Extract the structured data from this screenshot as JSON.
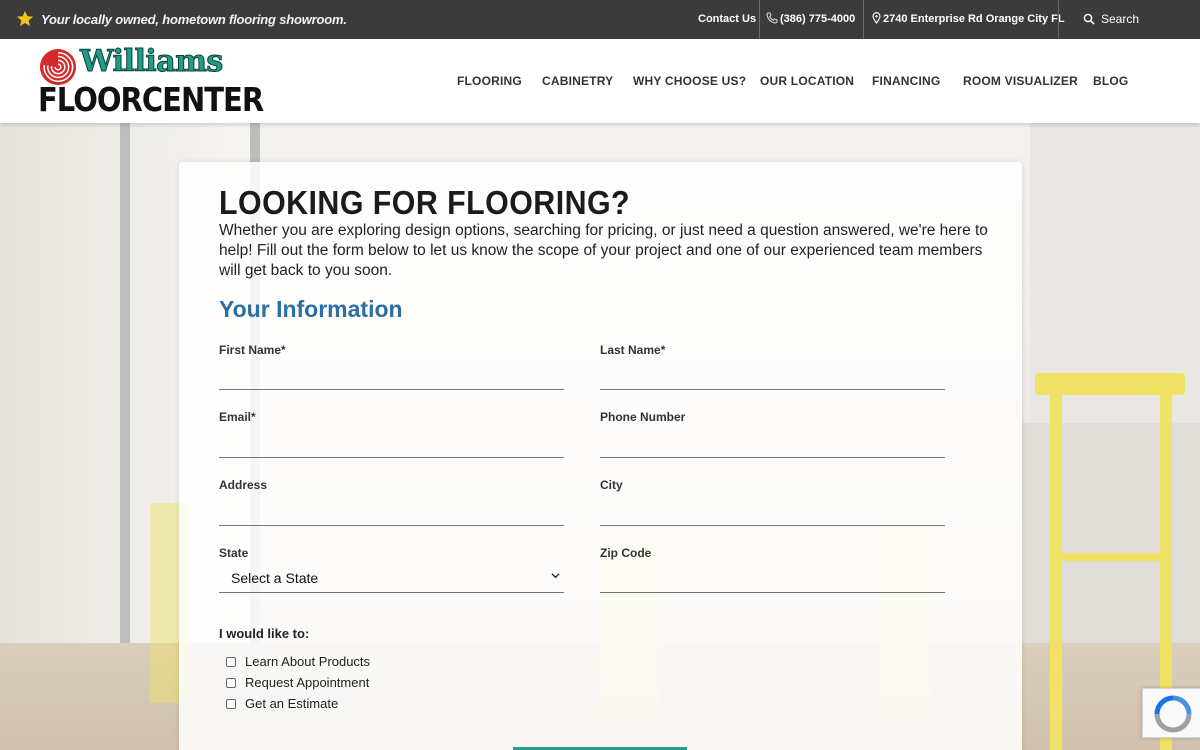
{
  "topbar": {
    "tagline": "Your locally owned, hometown flooring showroom.",
    "contact": "Contact Us",
    "phone": "(386) 775-4000",
    "address": "2740 Enterprise Rd Orange City FL",
    "search": "Search"
  },
  "header": {
    "logo_line1": "Williams",
    "logo_line2": "FLOORCENTER",
    "nav": [
      "FLOORING",
      "CABINETRY",
      "WHY CHOOSE US?",
      "OUR LOCATION",
      "FINANCING",
      "ROOM VISUALIZER",
      "BLOG"
    ]
  },
  "form": {
    "title": "LOOKING FOR FLOORING?",
    "intro": "Whether you are exploring design options, searching for pricing, or just need a question answered, we're here to help! Fill out the form below to let us know the scope of your project and one of our experienced team members will get back to you soon.",
    "section": "Your Information",
    "fields": {
      "first_name": "First Name*",
      "last_name": "Last Name*",
      "email": "Email*",
      "phone": "Phone Number",
      "address": "Address",
      "city": "City",
      "state": "State",
      "zip": "Zip Code"
    },
    "state_selected": "Select a State",
    "checkbox_title": "I would like to:",
    "checkboxes": [
      "Learn About Products",
      "Request Appointment",
      "Get an Estimate"
    ]
  },
  "colors": {
    "topbar": "#3b3b3b",
    "accent": "#2b6ea3",
    "brand_teal": "#1e9e8a",
    "brand_red": "#d42a2a",
    "star": "#f0c419"
  }
}
